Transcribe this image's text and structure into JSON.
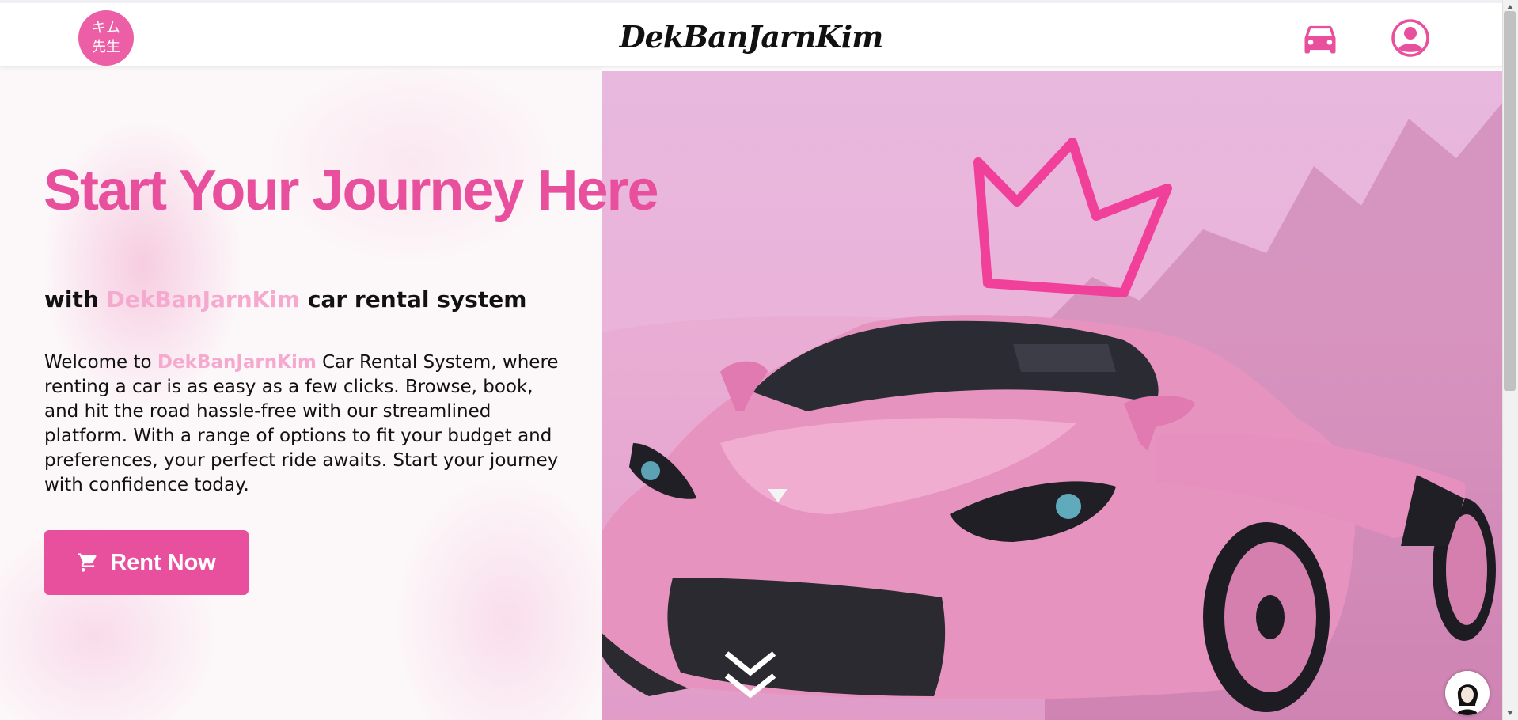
{
  "header": {
    "logo_line1": "キム",
    "logo_line2": "先生",
    "brand": "DekBanJarnKim",
    "icons": [
      "car-icon",
      "user-account-icon"
    ]
  },
  "hero": {
    "headline": "Start Your Journey Here",
    "subheadline_prefix": "with",
    "subheadline_brand": "DekBanJarnKim",
    "subheadline_suffix": "car rental system",
    "description_prefix": "Welcome to",
    "description_brand": "DekBanJarnKim",
    "description_suffix": "Car Rental System, where renting a car is as easy as a few clicks. Browse, book, and hit the road hassle-free with our streamlined platform. With a range of options to fit your budget and preferences, your perfect ride awaits. Start your journey with confidence today.",
    "rent_button_label": "Rent Now",
    "rent_button_icon": "cart-icon",
    "scroll_icon": "double-chevron-down-icon"
  },
  "colors": {
    "accent": "#e8509e",
    "brand_highlight": "#f5a9cf",
    "logo_badge": "#ec5fa6",
    "text": "#111111"
  }
}
